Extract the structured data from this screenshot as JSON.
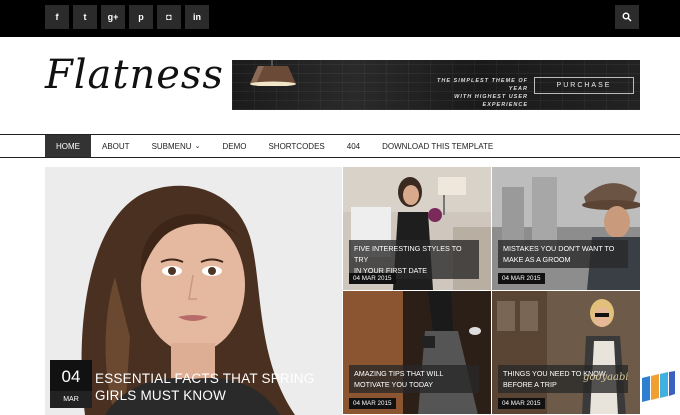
{
  "social": [
    {
      "icon": "facebook-icon",
      "glyph": "f"
    },
    {
      "icon": "twitter-icon",
      "glyph": "t"
    },
    {
      "icon": "google-plus-icon",
      "glyph": "g+"
    },
    {
      "icon": "pinterest-icon",
      "glyph": "p"
    },
    {
      "icon": "instagram-icon",
      "glyph": "◘"
    },
    {
      "icon": "linkedin-icon",
      "glyph": "in"
    }
  ],
  "logo": "Flatness",
  "banner": {
    "line1": "THE SIMPLEST THEME OF YEAR",
    "line2": "WITH HIGHEST USER EXPERIENCE",
    "button": "PURCHASE"
  },
  "nav": {
    "items": [
      {
        "label": "HOME",
        "active": true
      },
      {
        "label": "ABOUT"
      },
      {
        "label": "SUBMENU",
        "dropdown": true
      },
      {
        "label": "DEMO"
      },
      {
        "label": "SHORTCODES"
      },
      {
        "label": "404"
      },
      {
        "label": "DOWNLOAD THIS TEMPLATE"
      }
    ]
  },
  "hero": {
    "day": "04",
    "month": "MAR",
    "title_line1": "ESSENTIAL FACTS THAT SPRING",
    "title_line2": "GIRLS MUST KNOW"
  },
  "posts": [
    {
      "line1": "FIVE INTERESTING STYLES TO TRY",
      "line2": "IN YOUR FIRST DATE",
      "date": "04 MAR 2015"
    },
    {
      "line1": "MISTAKES YOU DON'T WANT TO",
      "line2": "MAKE AS A GROOM",
      "date": "04 MAR 2015"
    },
    {
      "line1": "AMAZING TIPS THAT WILL",
      "line2": "MOTIVATE YOU TODAY",
      "date": "04 MAR 2015"
    },
    {
      "line1": "THINGS YOU NEED TO KNOW",
      "line2": "BEFORE A TRIP",
      "date": "04 MAR 2015"
    }
  ],
  "watermark": "gooyaabi"
}
